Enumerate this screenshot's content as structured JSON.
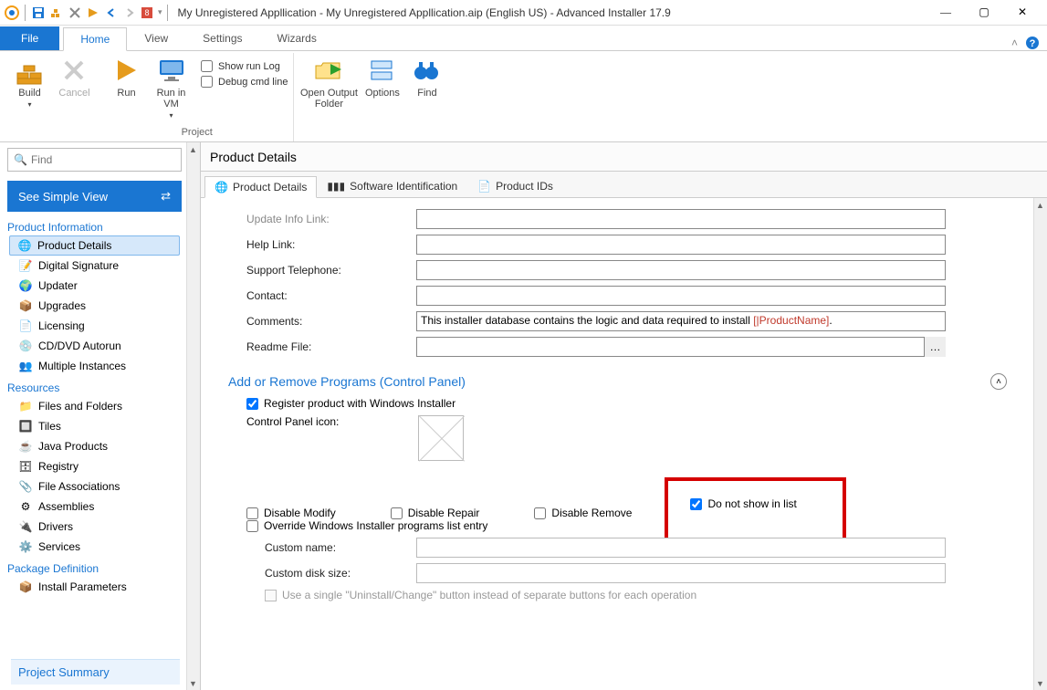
{
  "title": "My Unregistered Appllication - My Unregistered Appllication.aip (English US) - Advanced Installer 17.9",
  "menu": {
    "file": "File",
    "home": "Home",
    "view": "View",
    "settings": "Settings",
    "wizards": "Wizards"
  },
  "ribbon": {
    "build": "Build",
    "cancel": "Cancel",
    "run": "Run",
    "runvm": "Run in\nVM",
    "showrun": "Show run Log",
    "debugcmd": "Debug cmd line",
    "openout": "Open Output\nFolder",
    "options": "Options",
    "find": "Find",
    "projectGroup": "Project"
  },
  "sidebar": {
    "searchPlaceholder": "Find",
    "simpleView": "See Simple View",
    "sectionInfo": "Product Information",
    "sectionRes": "Resources",
    "sectionPkg": "Package Definition",
    "projectSummary": "Project Summary",
    "items": {
      "productDetails": "Product Details",
      "digitalSig": "Digital Signature",
      "updater": "Updater",
      "upgrades": "Upgrades",
      "licensing": "Licensing",
      "cddvd": "CD/DVD Autorun",
      "multi": "Multiple Instances",
      "files": "Files and Folders",
      "tiles": "Tiles",
      "java": "Java Products",
      "registry": "Registry",
      "fileassoc": "File Associations",
      "assemblies": "Assemblies",
      "drivers": "Drivers",
      "services": "Services",
      "installparams": "Install Parameters"
    }
  },
  "main": {
    "header": "Product Details",
    "tabs": {
      "pd": "Product Details",
      "si": "Software Identification",
      "pids": "Product IDs"
    },
    "labels": {
      "uil": "Update Info Link:",
      "helplink": "Help Link:",
      "tel": "Support Telephone:",
      "contact": "Contact:",
      "comments": "Comments:",
      "commentsPre": "This installer database contains the logic and data required to install ",
      "commentsTok": "[|ProductName]",
      "commentsSuf": ".",
      "readme": "Readme File:",
      "arpSection": "Add or Remove Programs (Control Panel)",
      "registerChk": "Register product with Windows Installer",
      "cpicon": "Control Panel icon:",
      "disableModify": "Disable Modify",
      "disableRepair": "Disable Repair",
      "disableRemove": "Disable Remove",
      "dontShow": "Do not show in list",
      "override": "Override Windows Installer programs list entry",
      "customName": "Custom name:",
      "customDisk": "Custom disk size:",
      "singleBtn": "Use a single \"Uninstall/Change\" button instead of separate buttons for each operation"
    }
  }
}
